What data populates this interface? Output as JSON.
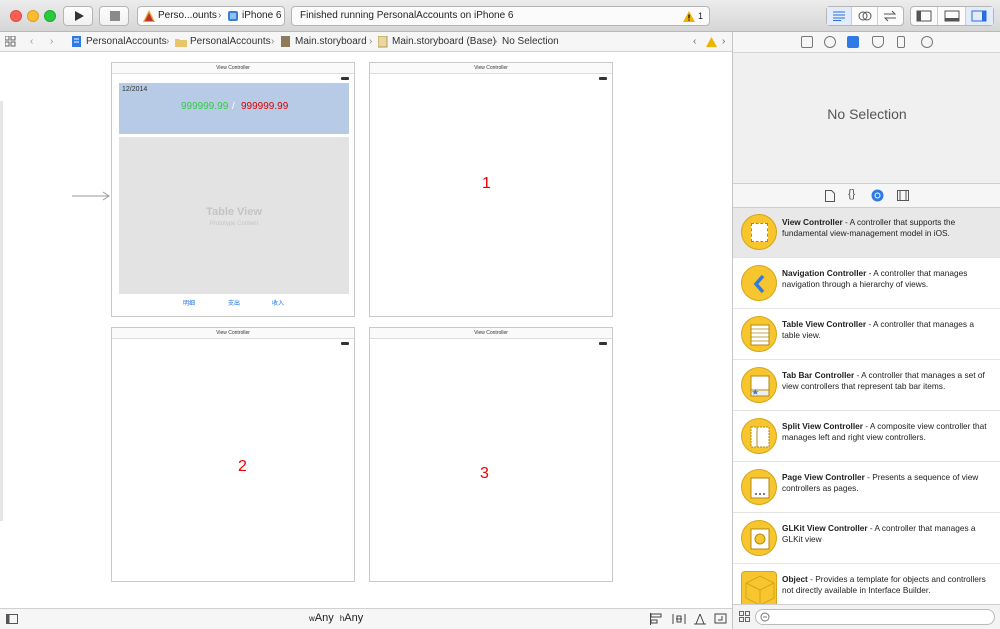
{
  "toolbar": {
    "scheme_target": "Perso...ounts",
    "scheme_device": "iPhone 6",
    "status_text": "Finished running PersonalAccounts on iPhone 6",
    "warning_count": "1"
  },
  "jumpbar": {
    "items": [
      "PersonalAccounts",
      "PersonalAccounts",
      "Main.storyboard",
      "Main.storyboard (Base)",
      "No Selection"
    ]
  },
  "canvas": {
    "scenes": [
      {
        "title": "View Controller"
      },
      {
        "title": "View Controller",
        "label": "1"
      },
      {
        "title": "View Controller",
        "label": "2"
      },
      {
        "title": "View Controller",
        "label": "3"
      }
    ],
    "header": {
      "date": "12/2014",
      "income": "999999.99",
      "separator": "/",
      "expense": "999999.99"
    },
    "table_view": {
      "title": "Table View",
      "subtitle": "Prototype Content"
    },
    "tab_buttons": [
      "明细",
      "支出",
      "收入"
    ]
  },
  "bottombar": {
    "w_prefix": "w",
    "w_value": "Any",
    "h_prefix": "h",
    "h_value": "Any"
  },
  "inspector": {
    "no_selection": "No Selection"
  },
  "library": {
    "items": [
      {
        "name": "View Controller",
        "desc": " - A controller that supports the fundamental view-management model in iOS."
      },
      {
        "name": "Navigation Controller",
        "desc": " - A controller that manages navigation through a hierarchy of views."
      },
      {
        "name": "Table View Controller",
        "desc": " - A controller that manages a table view."
      },
      {
        "name": "Tab Bar Controller",
        "desc": " - A controller that manages a set of view controllers that represent tab bar items."
      },
      {
        "name": "Split View Controller",
        "desc": " - A composite view controller that manages left and right view controllers."
      },
      {
        "name": "Page View Controller",
        "desc": " - Presents a sequence of view controllers as pages."
      },
      {
        "name": "GLKit View Controller",
        "desc": " - A controller that manages a GLKit view"
      },
      {
        "name": "Object",
        "desc": " - Provides a template for objects and controllers not directly available in Interface Builder."
      }
    ]
  },
  "colors": {
    "accent": "#1a73e8",
    "income": "#2ecc40",
    "expense": "#e00000",
    "warning": "#f0b400",
    "library_icon": "#f7c52e"
  }
}
